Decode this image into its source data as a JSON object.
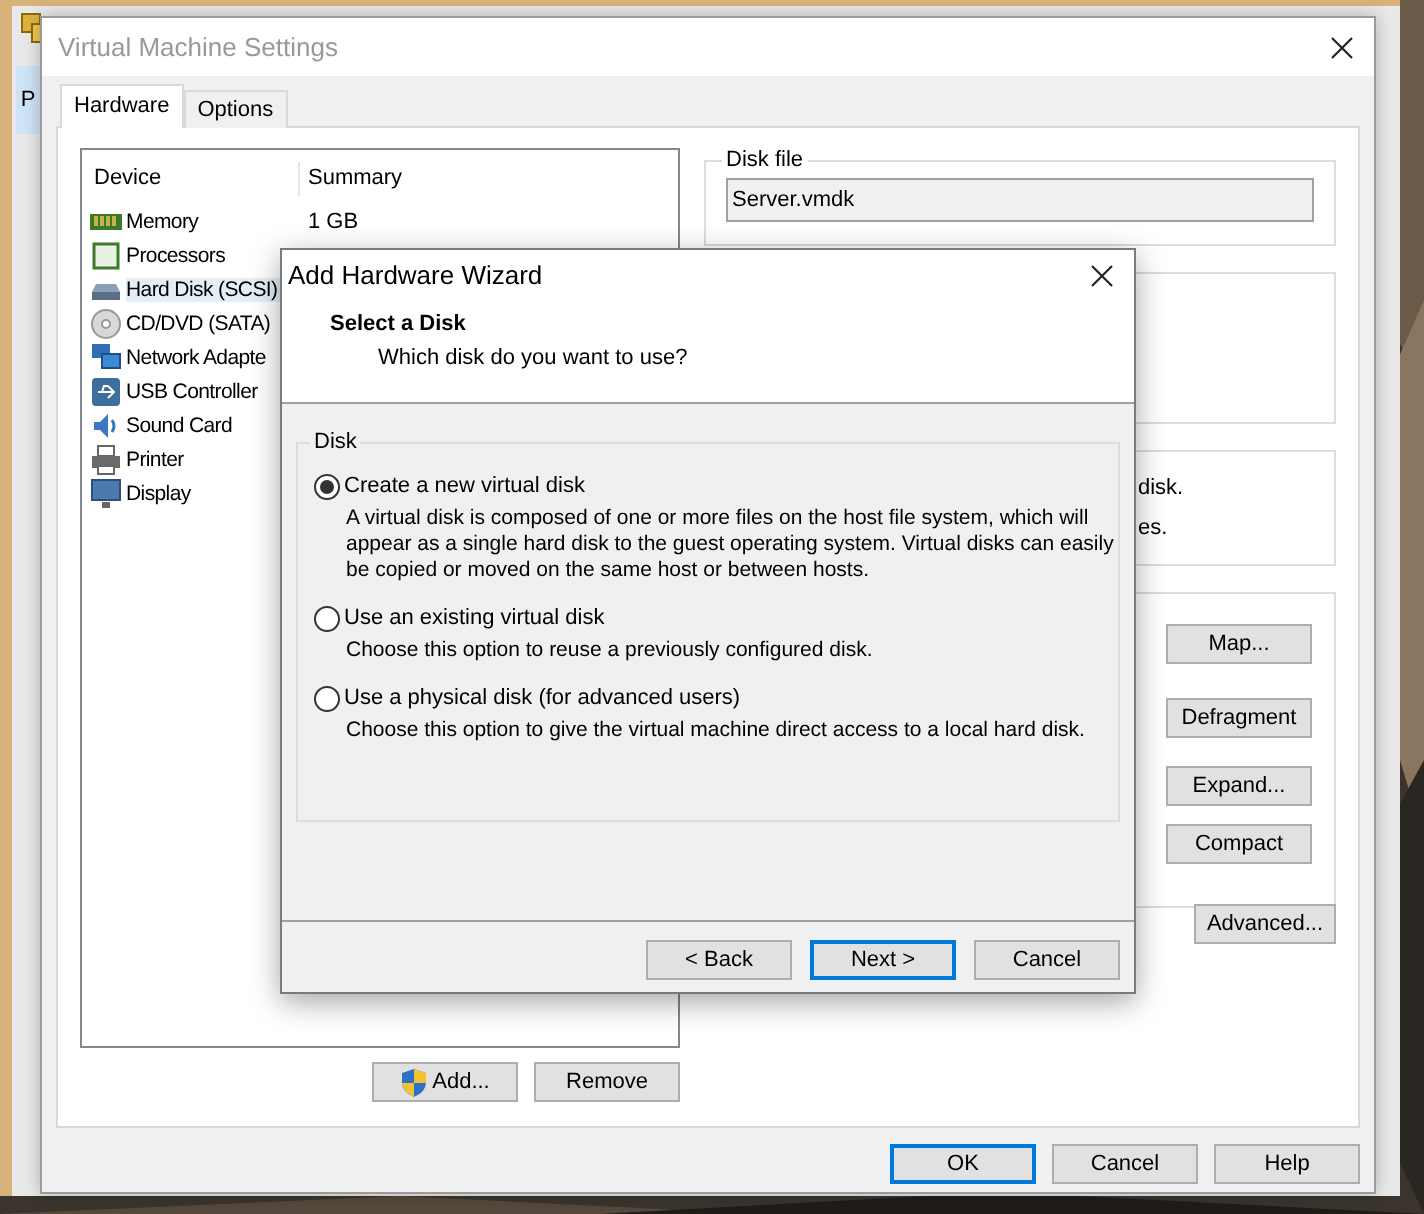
{
  "back_window": {
    "tab_label": "P"
  },
  "window": {
    "title": "Virtual Machine Settings"
  },
  "tabs": [
    {
      "label": "Hardware",
      "selected": true
    },
    {
      "label": "Options",
      "selected": false
    }
  ],
  "device_list": {
    "columns": [
      "Device",
      "Summary"
    ],
    "rows": [
      {
        "kind": "memory",
        "device": "Memory",
        "summary": "1 GB",
        "selected": false
      },
      {
        "kind": "processor",
        "device": "Processors",
        "selected": false
      },
      {
        "kind": "harddisk",
        "device": "Hard Disk (SCSI)",
        "selected": true
      },
      {
        "kind": "cd",
        "device": "CD/DVD (SATA)",
        "selected": false
      },
      {
        "kind": "network",
        "device": "Network Adapte",
        "selected": false
      },
      {
        "kind": "usb",
        "device": "USB Controller",
        "selected": false
      },
      {
        "kind": "sound",
        "device": "Sound Card",
        "selected": false
      },
      {
        "kind": "printer",
        "device": "Printer",
        "selected": false
      },
      {
        "kind": "display",
        "device": "Display",
        "selected": false
      }
    ]
  },
  "add_button": "Add...",
  "remove_button": "Remove",
  "disk_file": {
    "label": "Disk file",
    "value": "Server.vmdk"
  },
  "info_fragments": [
    "disk.",
    "es."
  ],
  "utility_buttons": [
    "Map...",
    "Defragment",
    "Expand...",
    "Compact"
  ],
  "advanced_button": "Advanced...",
  "dialog_buttons": [
    {
      "label": "OK",
      "default": true
    },
    {
      "label": "Cancel",
      "default": false
    },
    {
      "label": "Help",
      "default": false
    }
  ],
  "wizard": {
    "title": "Add Hardware Wizard",
    "heading": "Select a Disk",
    "subheading": "Which disk do you want to use?",
    "group_label": "Disk",
    "options": [
      {
        "label": "Create a new virtual disk",
        "description": "A virtual disk is composed of one or more files on the host file system, which will appear as a single hard disk to the guest operating system. Virtual disks can easily be copied or moved on the same host or between hosts.",
        "selected": true
      },
      {
        "label": "Use an existing virtual disk",
        "description": "Choose this option to reuse a previously configured disk.",
        "selected": false
      },
      {
        "label": "Use a physical disk (for advanced users)",
        "description": "Choose this option to give the virtual machine direct access to a local hard disk.",
        "selected": false
      }
    ],
    "buttons": [
      {
        "label": "< Back",
        "default": false
      },
      {
        "label": "Next >",
        "default": true
      },
      {
        "label": "Cancel",
        "default": false
      }
    ]
  }
}
